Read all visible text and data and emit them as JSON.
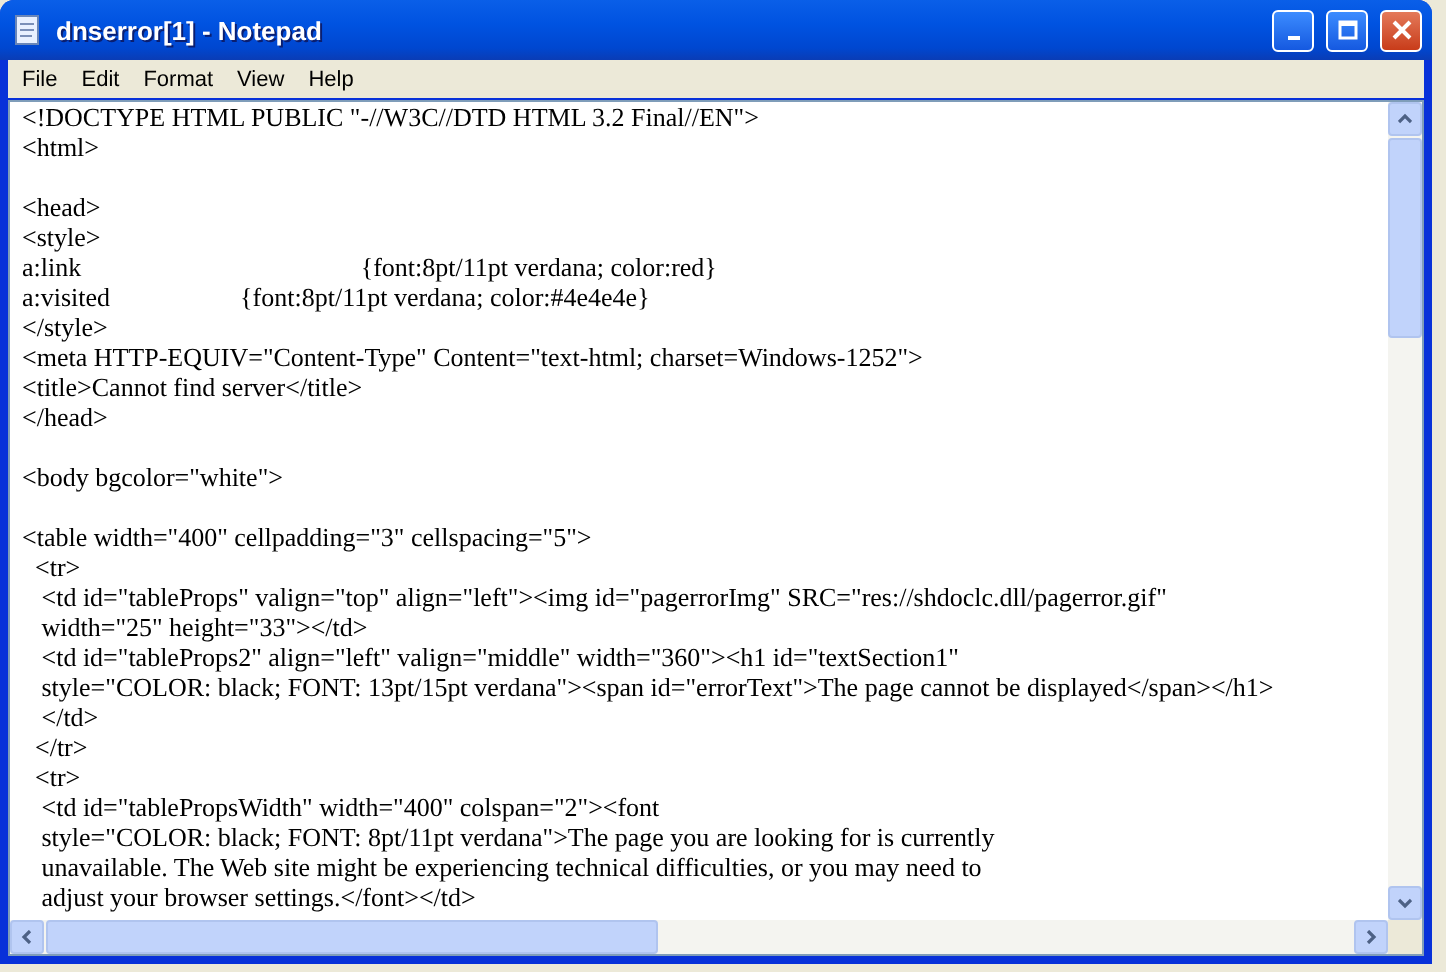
{
  "window": {
    "title": "dnserror[1] - Notepad"
  },
  "menu": [
    "File",
    "Edit",
    "Format",
    "View",
    "Help"
  ],
  "editor": {
    "blocks": [
      [
        "<!DOCTYPE HTML PUBLIC \"-//W3C//DTD HTML 3.2 Final//EN\">",
        "<html>"
      ],
      [
        "<head>",
        "<style>",
        "a:link                                           {font:8pt/11pt verdana; color:red}",
        "a:visited                    {font:8pt/11pt verdana; color:#4e4e4e}",
        "</style>",
        "<meta HTTP-EQUIV=\"Content-Type\" Content=\"text-html; charset=Windows-1252\">",
        "<title>Cannot find server</title>",
        "</head>"
      ],
      [
        "<body bgcolor=\"white\">"
      ],
      [
        "<table width=\"400\" cellpadding=\"3\" cellspacing=\"5\">",
        "  <tr>",
        "   <td id=\"tableProps\" valign=\"top\" align=\"left\"><img id=\"pagerrorImg\" SRC=\"res://shdoclc.dll/pagerror.gif\"",
        "   width=\"25\" height=\"33\"></td>",
        "   <td id=\"tableProps2\" align=\"left\" valign=\"middle\" width=\"360\"><h1 id=\"textSection1\"",
        "   style=\"COLOR: black; FONT: 13pt/15pt verdana\"><span id=\"errorText\">The page cannot be displayed</span></h1>",
        "   </td>",
        "  </tr>",
        "  <tr>",
        "   <td id=\"tablePropsWidth\" width=\"400\" colspan=\"2\"><font",
        "   style=\"COLOR: black; FONT: 8pt/11pt verdana\">The page you are looking for is currently",
        "   unavailable. The Web site might be experiencing technical difficulties, or you may need to",
        "   adjust your browser settings.</font></td>"
      ]
    ]
  }
}
